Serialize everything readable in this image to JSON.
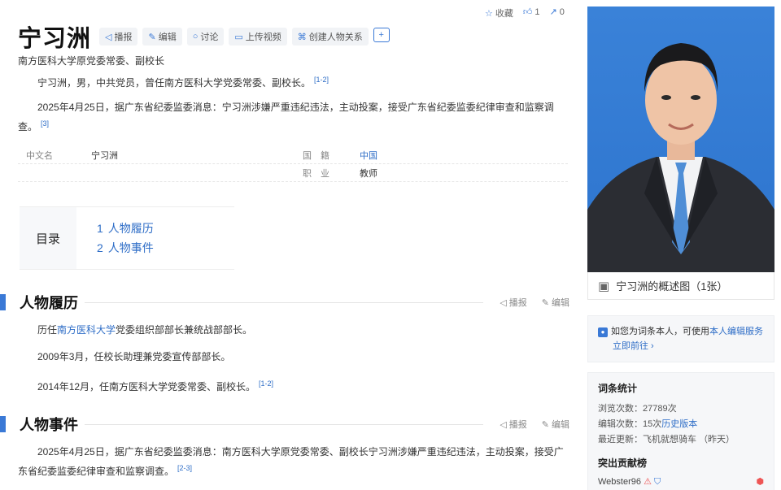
{
  "title": "宁习洲",
  "toolbar": {
    "broadcast": "播报",
    "edit": "编辑",
    "discuss": "讨论",
    "upload_video": "上传视频",
    "create_relation": "创建人物关系",
    "add": "+"
  },
  "top_stats": {
    "favorite": "收藏",
    "likes": "1",
    "shares": "0"
  },
  "subtitle": "南方医科大学原党委常委、副校长",
  "intro": [
    {
      "text": "宁习洲，男，中共党员，曾任南方医科大学党委常委、副校长。",
      "ref": "[1-2]"
    },
    {
      "text": "2025年4月25日，据广东省纪委监委消息：宁习洲涉嫌严重违纪违法，主动投案，接受广东省纪委监委纪律审查和监察调查。",
      "ref": "[3]"
    }
  ],
  "infobox": {
    "row1": {
      "k1": "中文名",
      "v1": "宁习洲",
      "k2": "国　籍",
      "v2": "中国"
    },
    "row2": {
      "k2": "职　业",
      "v2": "教师"
    }
  },
  "toc": {
    "label": "目录",
    "items": [
      {
        "num": "1",
        "label": "人物履历"
      },
      {
        "num": "2",
        "label": "人物事件"
      }
    ]
  },
  "section1": {
    "title": "人物履历",
    "broadcast": "播报",
    "edit": "编辑",
    "p1_pre": "历任",
    "p1_link": "南方医科大学",
    "p1_post": "党委组织部部长兼统战部部长。",
    "p2": "2009年3月，任校长助理兼党委宣传部部长。",
    "p3": "2014年12月，任南方医科大学党委常委、副校长。",
    "p3_ref": "[1-2]"
  },
  "section2": {
    "title": "人物事件",
    "broadcast": "播报",
    "edit": "编辑",
    "p1": "2025年4月25日，据广东省纪委监委消息：南方医科大学原党委常委、副校长宁习洲涉嫌严重违纪违法，主动投案，接受广东省纪委监委纪律审查和监察调查。",
    "p1_ref": "[2-3]"
  },
  "sidebar": {
    "photo_caption": "宁习洲的概述图（1张）",
    "claim_text": "如您为词条本人，可使用",
    "claim_link": "本人编辑服务",
    "claim_go": "立即前往 ›",
    "stats_title": "词条统计",
    "views_label": "浏览次数：",
    "views": "27789次",
    "edits_label": "编辑次数：",
    "edits": "15次",
    "history_link": "历史版本",
    "updated_label": "最近更新：",
    "updated": "飞机就想骑车 （昨天）",
    "contrib_title": "突出贡献榜",
    "top_user": "Webster96"
  },
  "colors": {
    "accent": "#3a79d6",
    "link": "#2f6ec7",
    "photo_bg": "#2f78d2"
  }
}
